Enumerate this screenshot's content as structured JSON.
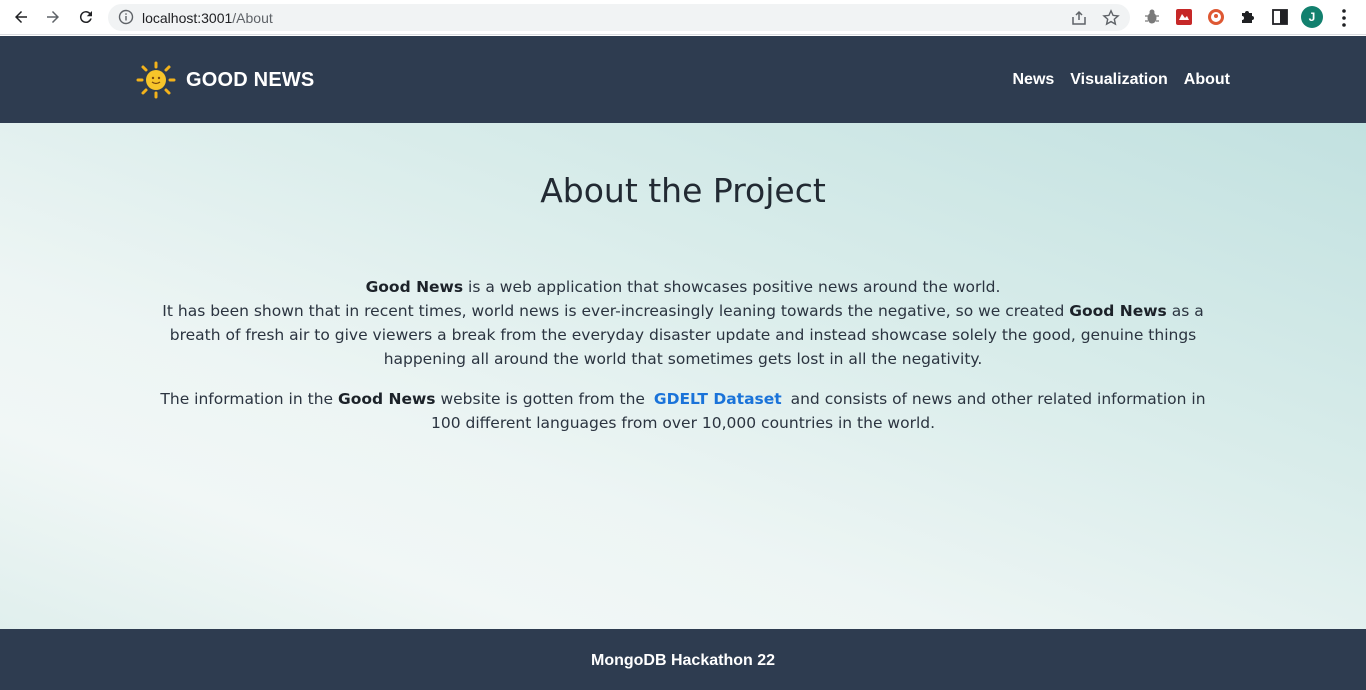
{
  "browser": {
    "url_host": "localhost:3001",
    "url_path": "/About",
    "profile_initial": "J"
  },
  "site": {
    "brand": "GOOD NEWS",
    "nav": [
      "News",
      "Visualization",
      "About"
    ]
  },
  "main": {
    "title": "About the Project",
    "p1_strong": "Good News",
    "p1_text": " is a web application that showcases positive news around the world.",
    "p2_text_a": "It has been shown that in recent times, world news is ever-increasingly leaning towards the negative, so we created ",
    "p2_strong": "Good News",
    "p2_text_b": " as a breath of fresh air to give viewers a break from the everyday disaster update and instead showcase solely the good, genuine things happening all around the world that sometimes gets lost in all the negativity.",
    "p3_text_a": "The information in the ",
    "p3_strong": "Good News",
    "p3_text_b": " website is gotten from the ",
    "p3_link": "GDELT Dataset",
    "p3_text_c": " and consists of news and other related information in 100 different languages from over 10,000 countries in the world."
  },
  "footer": {
    "text": "MongoDB Hackathon 22"
  },
  "colors": {
    "header_bg": "#2e3c50",
    "link": "#1a73d9",
    "profile": "#12806e"
  },
  "icons": [
    "back-icon",
    "forward-icon",
    "reload-icon",
    "info-icon",
    "share-icon",
    "star-icon",
    "bug-extension-icon",
    "red-extension-icon",
    "duckduckgo-extension-icon",
    "puzzle-extensions-icon",
    "side-panel-icon",
    "more-menu-icon",
    "sun-logo-icon"
  ]
}
